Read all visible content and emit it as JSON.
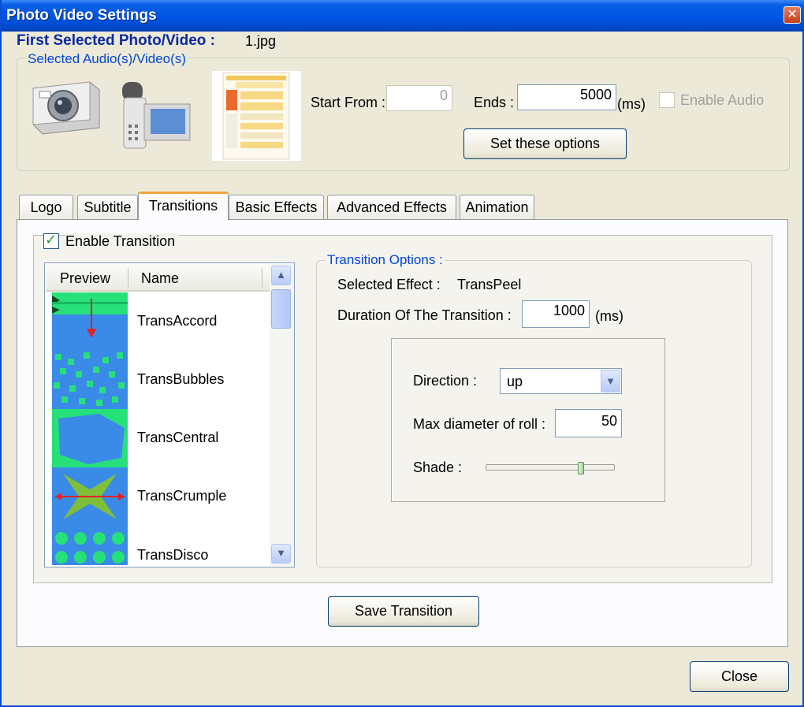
{
  "window": {
    "title": "Photo Video Settings"
  },
  "header": {
    "first_selected_label": "First Selected Photo/Video :",
    "first_selected_value": "1.jpg"
  },
  "media": {
    "legend": "Selected Audio(s)/Video(s)",
    "start_label": "Start From :",
    "start_value": "0",
    "ends_label": "Ends :",
    "ends_value": "5000",
    "ends_unit": "(ms)",
    "enable_audio_label": "Enable Audio",
    "enable_audio_checked": false,
    "set_options_label": "Set these options"
  },
  "tabs": [
    {
      "label": "Logo",
      "active": false
    },
    {
      "label": "Subtitle",
      "active": false
    },
    {
      "label": "Transitions",
      "active": true
    },
    {
      "label": "Basic Effects",
      "active": false
    },
    {
      "label": "Advanced Effects",
      "active": false
    },
    {
      "label": "Animation",
      "active": false
    }
  ],
  "transitions": {
    "enable_label": "Enable Transition",
    "enable_checked": true,
    "list": {
      "col_preview": "Preview",
      "col_name": "Name",
      "items": [
        "TransAccord",
        "TransBubbles",
        "TransCentral",
        "TransCrumple",
        "TransDisco"
      ]
    },
    "options": {
      "legend": "Transition Options :",
      "selected_effect_label": "Selected Effect :",
      "selected_effect_value": "TransPeel",
      "duration_label": "Duration Of The Transition :",
      "duration_value": "1000",
      "duration_unit": "(ms)",
      "direction_label": "Direction :",
      "direction_value": "up",
      "max_diameter_label": "Max diameter of roll :",
      "max_diameter_value": "50",
      "shade_label": "Shade :",
      "shade_level": 0.75
    },
    "save_label": "Save Transition"
  },
  "footer": {
    "close_label": "Close"
  },
  "colors": {
    "title_bar": "#0054e3",
    "label_blue": "#0a2a9c",
    "legend_blue": "#0046d5",
    "tab_highlight": "#f1a63b"
  }
}
